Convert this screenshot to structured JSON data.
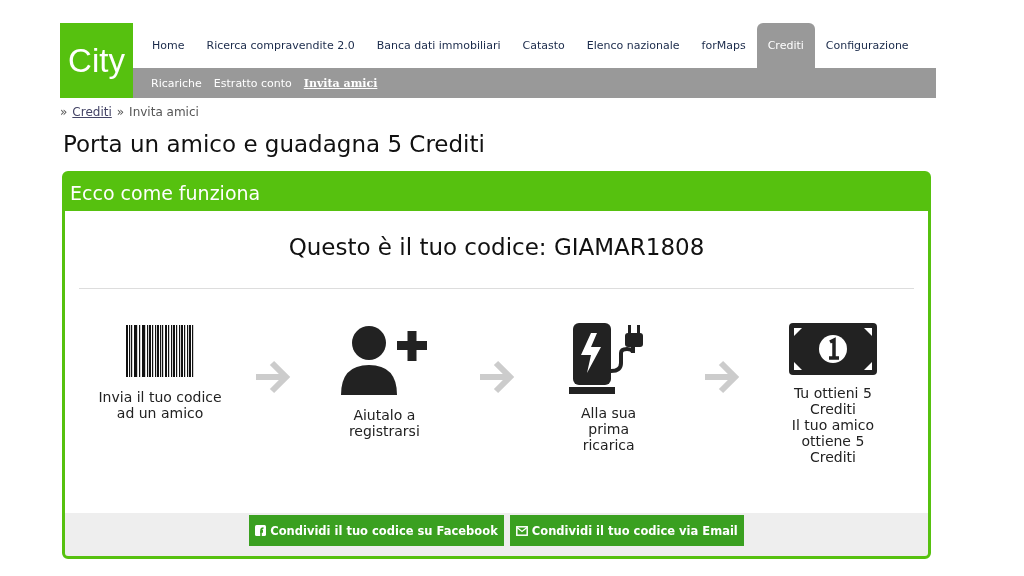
{
  "logo": "City",
  "nav": [
    {
      "label": "Home",
      "selected": false
    },
    {
      "label": "Ricerca compravendite 2.0",
      "selected": false
    },
    {
      "label": "Banca dati immobiliari",
      "selected": false
    },
    {
      "label": "Catasto",
      "selected": false
    },
    {
      "label": "Elenco nazionale",
      "selected": false
    },
    {
      "label": "forMaps",
      "selected": false
    },
    {
      "label": "Crediti",
      "selected": true
    },
    {
      "label": "Configurazione",
      "selected": false
    }
  ],
  "subnav": [
    {
      "label": "Ricariche",
      "selected": false
    },
    {
      "label": "Estratto conto",
      "selected": false
    },
    {
      "label": "Invita amici",
      "selected": true
    }
  ],
  "breadcrumb": [
    {
      "separator": "»",
      "label": "Crediti",
      "link": true
    },
    {
      "separator": "»",
      "label": "Invita amici",
      "link": false
    }
  ],
  "page_title": "Porta un amico e guadagna 5 Crediti",
  "panel": {
    "title": "Ecco come funziona",
    "code_text": "Questo è il tuo codice: GIAMAR1808",
    "steps": [
      {
        "kind": "barcode",
        "lines": [
          "Invia il tuo codice ad un amico"
        ]
      },
      {
        "kind": "user-plus",
        "lines": [
          "Aiutalo a registrarsi"
        ]
      },
      {
        "kind": "charger",
        "lines": [
          "Alla sua prima ricarica"
        ]
      },
      {
        "kind": "banknote",
        "lines": [
          "Tu ottieni 5 Crediti",
          "Il tuo amico ottiene 5 Crediti"
        ]
      }
    ],
    "buttons": [
      {
        "kind": "facebook",
        "label": "Condividi il tuo codice su Facebook"
      },
      {
        "kind": "email",
        "label": "Condividi il tuo codice via Email"
      }
    ]
  }
}
